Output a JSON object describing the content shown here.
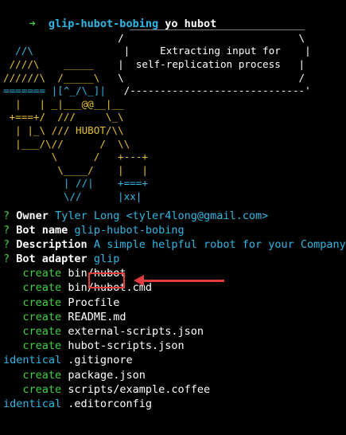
{
  "prompt": {
    "directory": "glip-hubot-bobing",
    "command": "yo hubot"
  },
  "speech": {
    "top": " _____________________________",
    "l1": "/                             \\",
    "l2": "|     Extracting input for    |",
    "l3": "|  self-replication process   |",
    "l4": "\\                             /",
    "bottom": " /-----------------------------'"
  },
  "ascii_robot": {
    "r1": "  //\\",
    "r2": " ////\\    _____",
    "r3": "//////\\  /_____\\",
    "r4": "======= |[^_/\\_]|",
    "r5": "  |   | _|___@@__|__",
    "r6": " +===+/  ///     \\_\\",
    "r7": "  | |_\\ /// HUBOT/\\\\",
    "r8": "  |___/\\//      /  \\\\",
    "r9": "        \\      /   +---+",
    "r10": "         \\____/    |   |",
    "r11": "          | //|    +===+",
    "r12": "          \\//      |xx|"
  },
  "answers": [
    {
      "mark": "?",
      "question": "Owner",
      "answer": "Tyler Long <tyler4long@gmail.com>"
    },
    {
      "mark": "?",
      "question": "Bot name",
      "answer": "glip-hubot-bobing"
    },
    {
      "mark": "?",
      "question": "Description",
      "answer": "A simple helpful robot for your Company"
    },
    {
      "mark": "?",
      "question": "Bot adapter",
      "answer": "glip"
    }
  ],
  "file_log": [
    {
      "action": "create",
      "path": "bin/hubot"
    },
    {
      "action": "create",
      "path": "bin/hubot.cmd"
    },
    {
      "action": "create",
      "path": "Procfile"
    },
    {
      "action": "create",
      "path": "README.md"
    },
    {
      "action": "create",
      "path": "external-scripts.json"
    },
    {
      "action": "create",
      "path": "hubot-scripts.json"
    },
    {
      "action": "identical",
      "path": ".gitignore"
    },
    {
      "action": "create",
      "path": "package.json"
    },
    {
      "action": "create",
      "path": "scripts/example.coffee"
    },
    {
      "action": "identical",
      "path": ".editorconfig"
    }
  ],
  "colors": {
    "background": "#000000",
    "prompt_green": "#3fd13f",
    "answer_cyan": "#2fb7e5",
    "robot_yellow": "#e5c12b",
    "annotation_red": "#e03c3c"
  }
}
